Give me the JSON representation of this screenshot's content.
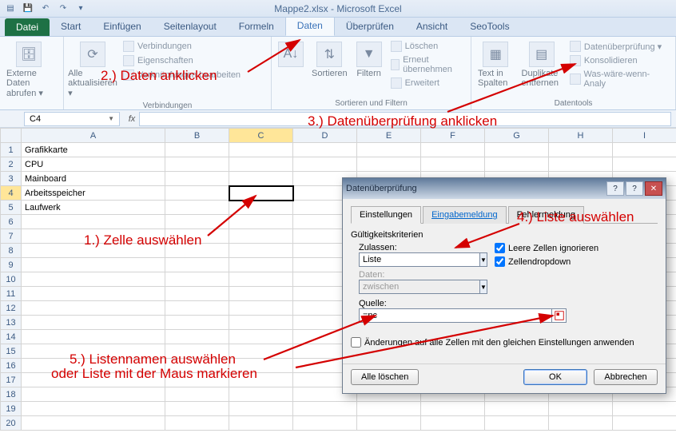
{
  "title": "Mappe2.xlsx - Microsoft Excel",
  "tabs": {
    "file": "Datei",
    "items": [
      "Start",
      "Einfügen",
      "Seitenlayout",
      "Formeln",
      "Daten",
      "Überprüfen",
      "Ansicht",
      "SeoTools"
    ],
    "active": "Daten"
  },
  "ribbon": {
    "g1": {
      "btn": "Externe Daten abrufen ▾"
    },
    "g2": {
      "btn": "Alle aktualisieren ▾",
      "a": "Verbindungen",
      "b": "Eigenschaften",
      "c": "Verknüpfungen bearbeiten",
      "label": "Verbindungen"
    },
    "g3": {
      "sort": "Sortieren",
      "filter": "Filtern",
      "a": "Löschen",
      "b": "Erneut übernehmen",
      "c": "Erweitert",
      "label": "Sortieren und Filtern"
    },
    "g4": {
      "a": "Text in Spalten",
      "b": "Duplikate entfernen",
      "c": "Datenüberprüfung ▾",
      "d": "Konsolidieren",
      "e": "Was-wäre-wenn-Analy",
      "label": "Datentools"
    }
  },
  "namebox": "C4",
  "columns": [
    "A",
    "B",
    "C",
    "D",
    "E",
    "F",
    "G",
    "H",
    "I"
  ],
  "rows": {
    "1": "Grafikkarte",
    "2": "CPU",
    "3": "Mainboard",
    "4": "Arbeitsspeicher",
    "5": "Laufwerk"
  },
  "dialog": {
    "title": "Datenüberprüfung",
    "tabs": [
      "Einstellungen",
      "Eingabemeldung",
      "Fehlermeldung"
    ],
    "criteria_label": "Gültigkeitskriterien",
    "allow_label": "Zulassen:",
    "allow_value": "Liste",
    "data_label": "Daten:",
    "data_value": "zwischen",
    "ignore_blank": "Leere Zellen ignorieren",
    "dropdown": "Zellendropdown",
    "source_label": "Quelle:",
    "source_value": "=pc",
    "apply_all": "Änderungen auf alle Zellen mit den gleichen Einstellungen anwenden",
    "clear": "Alle löschen",
    "ok": "OK",
    "cancel": "Abbrechen"
  },
  "annotations": {
    "a1": "1.) Zelle auswählen",
    "a2": "2.) Daten anklicken",
    "a3": "3.) Datenüberprüfung anklicken",
    "a4": "4.) Liste auswählen",
    "a5a": "5.) Listennamen auswählen",
    "a5b": "oder Liste mit der Maus markieren"
  }
}
